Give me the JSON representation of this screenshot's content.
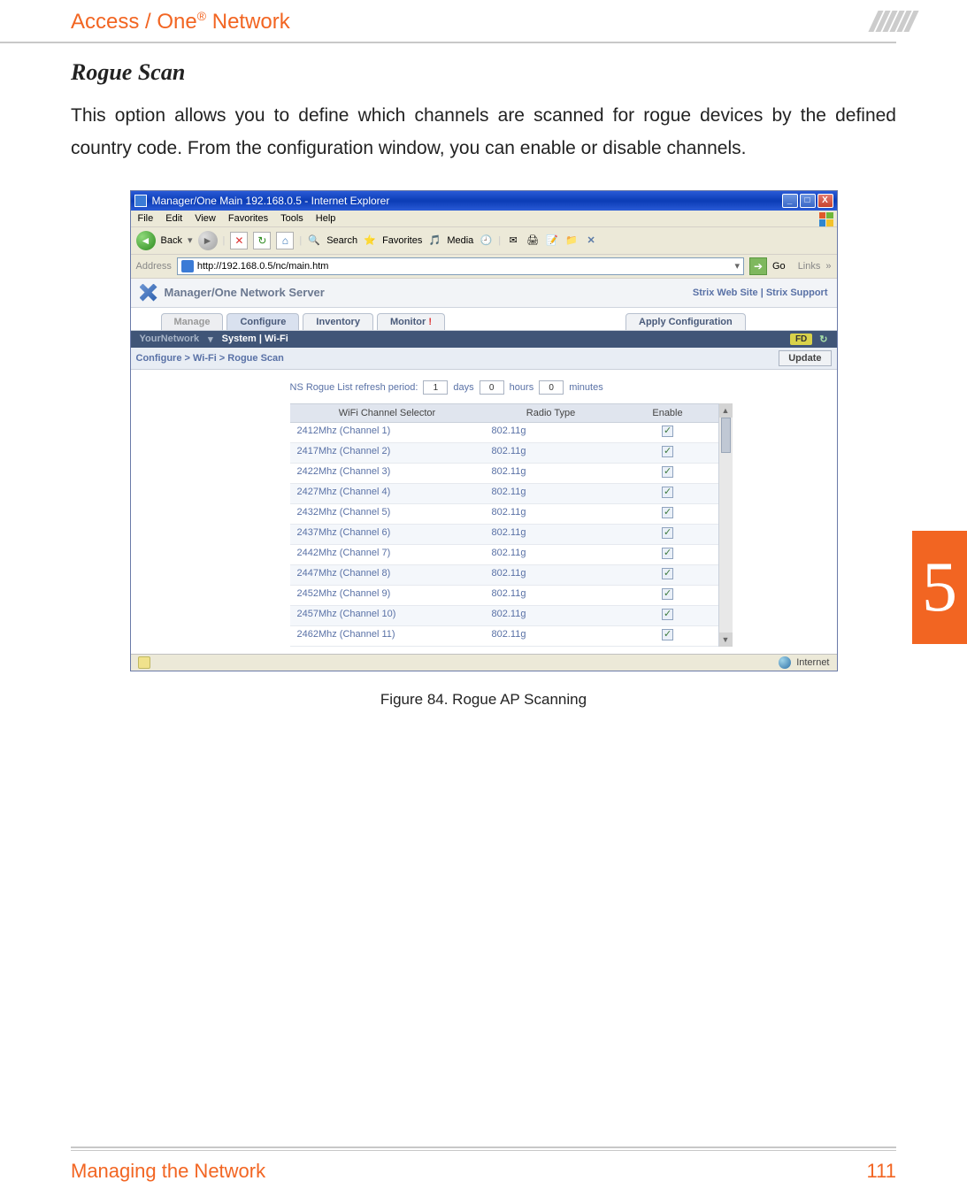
{
  "page": {
    "header_title_pre": "Access / One",
    "header_title_sup": "®",
    "header_title_post": " Network",
    "section_title": "Rogue Scan",
    "body_paragraph": "This option allows you to define which channels are scanned for rogue devices by the defined country code. From the configuration window, you can enable or disable channels.",
    "figure_caption": "Figure 84. Rogue AP Scanning",
    "side_tab": "5",
    "footer_left": "Managing the Network",
    "footer_right": "111"
  },
  "screenshot": {
    "window_title": "Manager/One Main 192.168.0.5 - Internet Explorer",
    "win_buttons": {
      "min": "_",
      "max": "□",
      "close": "X"
    },
    "menubar": [
      "File",
      "Edit",
      "View",
      "Favorites",
      "Tools",
      "Help"
    ],
    "toolbar": {
      "back": "Back",
      "search": "Search",
      "favorites": "Favorites",
      "media": "Media"
    },
    "addressbar": {
      "label": "Address",
      "url": "http://192.168.0.5/nc/main.htm",
      "go": "Go",
      "links": "Links"
    },
    "net_header": {
      "title": "Manager/One Network Server",
      "right": "Strix Web Site  |  Strix Support"
    },
    "tabs": {
      "manage": "Manage",
      "configure": "Configure",
      "inventory": "Inventory",
      "monitor": "Monitor",
      "apply": "Apply Configuration"
    },
    "subnav": {
      "network": "YourNetwork",
      "items": "System  |  Wi-Fi",
      "badge": "FD",
      "refresh": "↻"
    },
    "breadcrumb": "Configure > Wi-Fi > Rogue Scan",
    "update_button": "Update",
    "refresh_period": {
      "label": "NS Rogue List refresh period:",
      "days_val": "1",
      "days_lbl": "days",
      "hours_val": "0",
      "hours_lbl": "hours",
      "minutes_val": "0",
      "minutes_lbl": "minutes"
    },
    "table": {
      "headers": {
        "c1": "WiFi Channel Selector",
        "c2": "Radio Type",
        "c3": "Enable"
      },
      "rows": [
        {
          "channel": "2412Mhz (Channel 1)",
          "radio": "802.11g",
          "enabled": true
        },
        {
          "channel": "2417Mhz (Channel 2)",
          "radio": "802.11g",
          "enabled": true
        },
        {
          "channel": "2422Mhz (Channel 3)",
          "radio": "802.11g",
          "enabled": true
        },
        {
          "channel": "2427Mhz (Channel 4)",
          "radio": "802.11g",
          "enabled": true
        },
        {
          "channel": "2432Mhz (Channel 5)",
          "radio": "802.11g",
          "enabled": true
        },
        {
          "channel": "2437Mhz (Channel 6)",
          "radio": "802.11g",
          "enabled": true
        },
        {
          "channel": "2442Mhz (Channel 7)",
          "radio": "802.11g",
          "enabled": true
        },
        {
          "channel": "2447Mhz (Channel 8)",
          "radio": "802.11g",
          "enabled": true
        },
        {
          "channel": "2452Mhz (Channel 9)",
          "radio": "802.11g",
          "enabled": true
        },
        {
          "channel": "2457Mhz (Channel 10)",
          "radio": "802.11g",
          "enabled": true
        },
        {
          "channel": "2462Mhz (Channel 11)",
          "radio": "802.11g",
          "enabled": true
        }
      ]
    },
    "statusbar": {
      "internet": "Internet"
    }
  }
}
